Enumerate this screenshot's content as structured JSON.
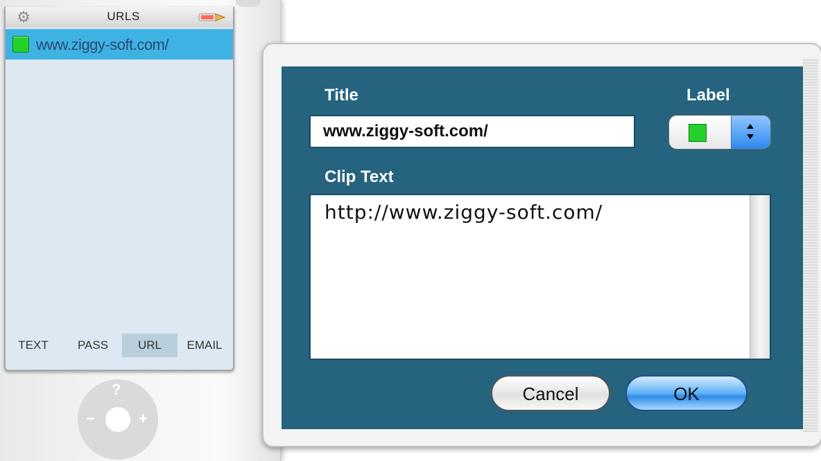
{
  "sidebar": {
    "header_title": "URLS",
    "items": [
      {
        "label": "www.ziggy-soft.com/",
        "color": "#22d22a"
      }
    ],
    "tabs": [
      "TEXT",
      "PASS",
      "URL",
      "EMAIL"
    ],
    "active_tab": "URL",
    "wheel": {
      "top": "?",
      "left": "−",
      "right": "+"
    },
    "icons": {
      "settings": "gear-icon",
      "edit": "bullet-icon"
    }
  },
  "dialog": {
    "title_label": "Title",
    "title_value": "www.ziggy-soft.com/",
    "label_label": "Label",
    "label_color": "#22d22a",
    "clip_label": "Clip Text",
    "clip_value": "http://www.ziggy-soft.com/",
    "cancel_label": "Cancel",
    "ok_label": "OK"
  },
  "colors": {
    "dialog_background": "#25637f",
    "selection": "#3fb2e4",
    "list_background": "#dde8f2"
  }
}
